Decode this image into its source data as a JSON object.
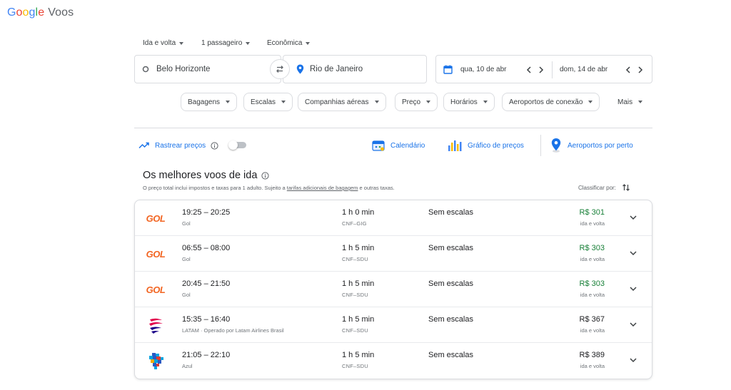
{
  "logo": {
    "letters": [
      "G",
      "o",
      "o",
      "g",
      "l",
      "e"
    ],
    "product": "Voos"
  },
  "trip_options": {
    "trip_type": "Ida e volta",
    "passengers": "1 passageiro",
    "cabin": "Econômica"
  },
  "search": {
    "origin": "Belo Horizonte",
    "destination": "Rio de Janeiro",
    "depart_date": "qua, 10 de abr",
    "return_date": "dom, 14 de abr"
  },
  "filters": [
    "Bagagens",
    "Escalas",
    "Companhias aéreas",
    "Preço",
    "Horários",
    "Aeroportos de conexão",
    "Mais"
  ],
  "tools": {
    "track_prices": "Rastrear preços",
    "calendar": "Calendário",
    "price_graph": "Gráfico de preços",
    "nearby_airports": "Aeroportos por perto"
  },
  "results": {
    "title": "Os melhores voos de ida",
    "subtitle_before": "O preço total inclui impostos e taxas para 1 adulto. Sujeito a ",
    "subtitle_link": "tarifas adicionais de bagagem",
    "subtitle_after": " e outras taxas.",
    "sort_label": "Classificar por:",
    "flights": [
      {
        "logo": "gol-logo",
        "logo_text": "GOL",
        "times": "19:25 – 20:25",
        "carrier": "Gol",
        "duration": "1 h 0 min",
        "route": "CNF–GIG",
        "stops": "Sem escalas",
        "price": "R$ 301",
        "price_note": "ida e volta",
        "cheap": true
      },
      {
        "logo": "gol-logo",
        "logo_text": "GOL",
        "times": "06:55 – 08:00",
        "carrier": "Gol",
        "duration": "1 h 5 min",
        "route": "CNF–SDU",
        "stops": "Sem escalas",
        "price": "R$ 303",
        "price_note": "ida e volta",
        "cheap": true
      },
      {
        "logo": "gol-logo",
        "logo_text": "GOL",
        "times": "20:45 – 21:50",
        "carrier": "Gol",
        "duration": "1 h 5 min",
        "route": "CNF–SDU",
        "stops": "Sem escalas",
        "price": "R$ 303",
        "price_note": "ida e volta",
        "cheap": true
      },
      {
        "logo": "latam-logo",
        "logo_text": "",
        "times": "15:35 – 16:40",
        "carrier": "LATAM · Operado por Latam Airlines Brasil",
        "duration": "1 h 5 min",
        "route": "CNF–SDU",
        "stops": "Sem escalas",
        "price": "R$ 367",
        "price_note": "ida e volta",
        "cheap": false
      },
      {
        "logo": "azul-logo",
        "logo_text": "",
        "times": "21:05 – 22:10",
        "carrier": "Azul",
        "duration": "1 h 5 min",
        "route": "CNF–SDU",
        "stops": "Sem escalas",
        "price": "R$ 389",
        "price_note": "ida e volta",
        "cheap": false
      }
    ]
  },
  "colors": {
    "accent": "#1a73e8",
    "price_green": "#188038",
    "gol_orange": "#f26522"
  }
}
